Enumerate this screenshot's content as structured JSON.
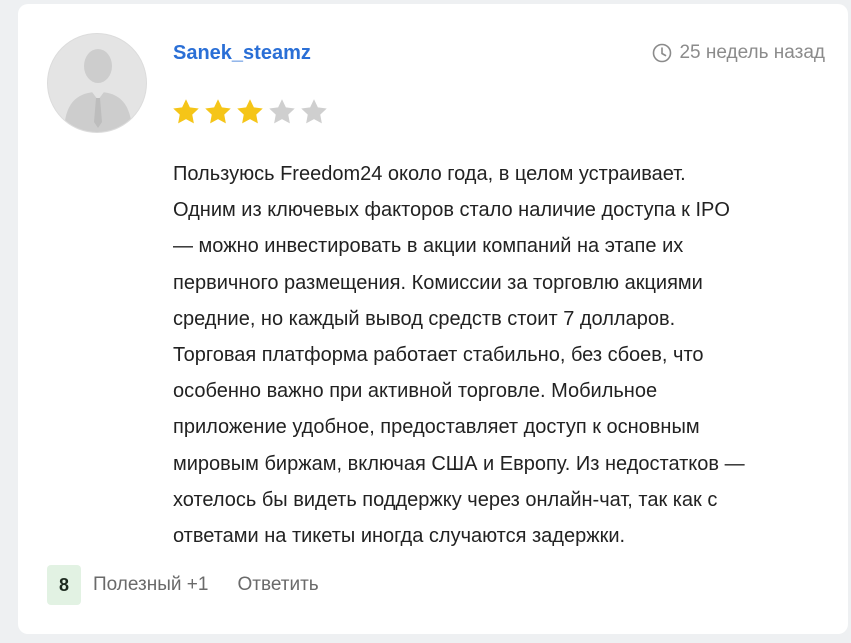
{
  "review": {
    "author": "Sanek_steamz",
    "time": "25 недель назад",
    "rating": 3,
    "max_rating": 5,
    "star_color": "#f5c518",
    "star_empty_color": "#cfcfcf",
    "lines": [
      "Пользуюсь Freedom24 около года, в целом устраивает.",
      "Одним из ключевых факторов стало наличие доступа к IPO",
      "— можно инвестировать в акции компаний на этапе их",
      "первичного размещения. Комиссии за торговлю акциями",
      "средние, но каждый вывод средств стоит 7 долларов.",
      "Торговая платформа работает стабильно, без сбоев, что",
      "особенно важно при активной торговле. Мобильное",
      "приложение удобное, предоставляет доступ к основным",
      "мировым биржам, включая США и Европу. Из недостатков —",
      "хотелось бы видеть поддержку через онлайн-чат, так как с",
      "ответами на тикеты иногда случаются задержки."
    ]
  },
  "footer": {
    "votes": "8",
    "helpful_label": "Полезный +1",
    "reply_label": "Ответить"
  },
  "colors": {
    "author_link": "#2a6fd6",
    "votes_badge_bg": "#e2f2e3"
  }
}
